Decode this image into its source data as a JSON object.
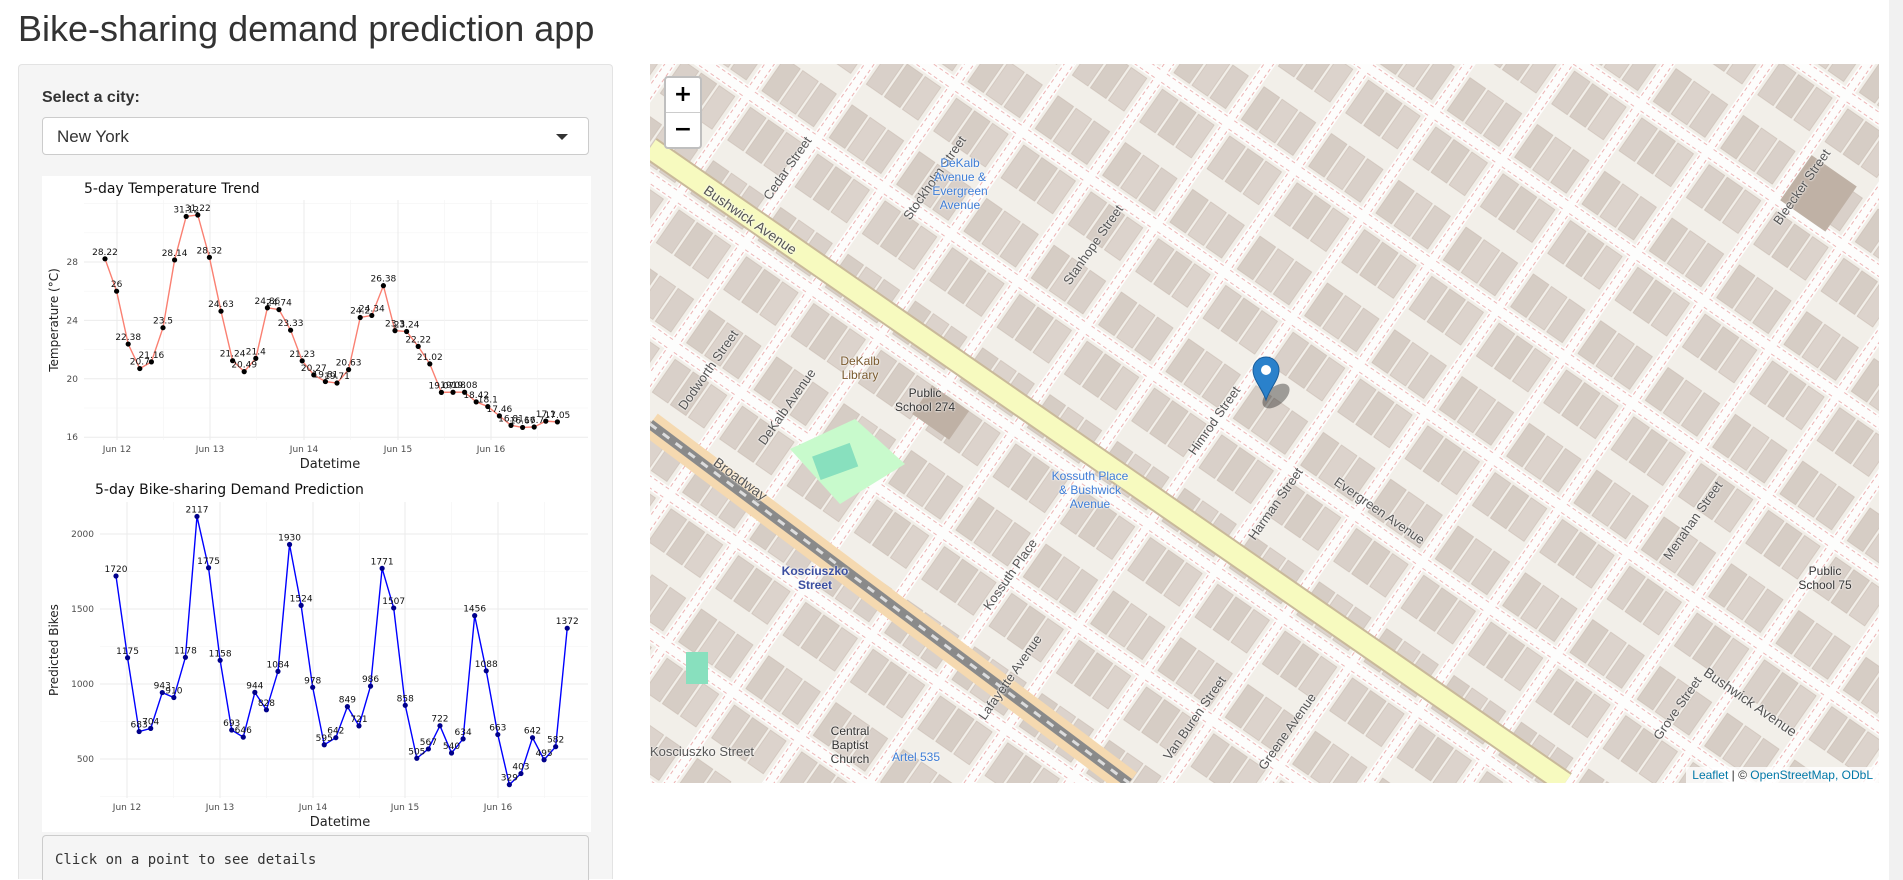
{
  "app": {
    "title": "Bike-sharing demand prediction app"
  },
  "sidebar": {
    "city_label": "Select a city:",
    "city_selected": "New York",
    "details_text": "Click on a point to see details"
  },
  "map": {
    "zoom_in": "+",
    "zoom_out": "−",
    "attribution_leaflet": "Leaflet",
    "attribution_sep": " | © ",
    "attribution_osm": "OpenStreetMap, ODbL",
    "labels": [
      "Bushwick Avenue",
      "Broadway",
      "Evergreen Avenue",
      "Harman Street",
      "Himrod Street",
      "Kosciuszko Street",
      "DeKalb Avenue",
      "Lafayette Avenue",
      "Van Buren Street",
      "Greene Avenue",
      "Menahan Street",
      "Bleecker Street",
      "Grove Street",
      "Stanhope Street",
      "Stockholm Street",
      "Cedar Street",
      "Dodworth Street",
      "Kossuth Place",
      "Bushwick Avenue"
    ],
    "pois": {
      "school274": "Public School 274",
      "library": "DeKalb Library",
      "church": "Central Baptist Church",
      "school75": "Public School 75",
      "dekalb_station": "DeKalb Avenue & Evergreen Avenue",
      "kossuth_station": "Kossuth Place & Bushwick Avenue",
      "kosciuszko_station": "Kosciuszko Street",
      "artel": "Artel 535"
    },
    "marker_color": "#2a81cb"
  },
  "chart_data": [
    {
      "type": "line",
      "title": "5-day Temperature Trend",
      "xlabel": "Datetime",
      "ylabel": "Temperature (°C)",
      "x_ticks": [
        "Jun 12",
        "Jun 13",
        "Jun 14",
        "Jun 15",
        "Jun 16"
      ],
      "y_ticks": [
        16,
        20,
        24,
        28
      ],
      "ylim": [
        15.5,
        32
      ],
      "interval_hours": 3,
      "color": "#fa8072",
      "values": [
        28.22,
        26,
        22.38,
        20.7,
        21.16,
        23.5,
        28.14,
        31.12,
        31.22,
        28.32,
        24.63,
        21.24,
        20.49,
        21.4,
        24.86,
        24.74,
        23.33,
        21.23,
        20.27,
        19.81,
        19.71,
        20.63,
        24.2,
        24.34,
        26.38,
        23.3,
        23.24,
        22.22,
        21.02,
        19.07,
        19.08,
        19.08,
        18.42,
        18.1,
        17.46,
        16.81,
        16.67,
        16.7,
        17.1,
        17.05
      ]
    },
    {
      "type": "line",
      "title": "5-day Bike-sharing Demand Prediction",
      "xlabel": "Datetime",
      "ylabel": "Predicted Bikes",
      "x_ticks": [
        "Jun 12",
        "Jun 13",
        "Jun 14",
        "Jun 15",
        "Jun 16"
      ],
      "y_ticks": [
        500,
        1000,
        1500,
        2000
      ],
      "ylim": [
        250,
        2200
      ],
      "interval_hours": 3,
      "color": "#0000ff",
      "values": [
        1720,
        1175,
        683,
        704,
        943,
        910,
        1178,
        2117,
        1775,
        1158,
        693,
        646,
        944,
        828,
        1084,
        1930,
        1524,
        978,
        595,
        642,
        849,
        721,
        986,
        1771,
        1507,
        858,
        505,
        567,
        722,
        540,
        634,
        1456,
        1088,
        663,
        329,
        403,
        642,
        495,
        582,
        1372
      ]
    }
  ]
}
